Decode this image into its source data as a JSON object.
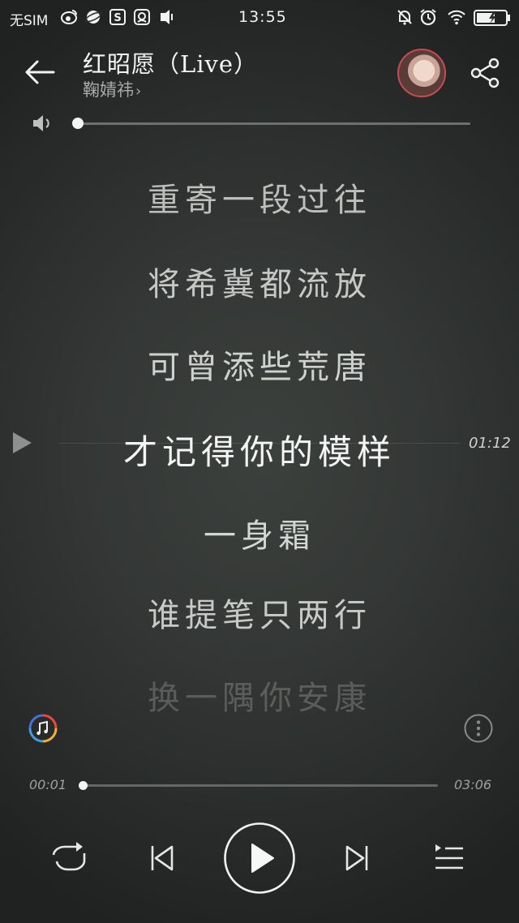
{
  "status_bar": {
    "sim": "无SIM",
    "time": "13:55",
    "icons": [
      "weibo-icon",
      "planet-icon",
      "s-icon",
      "qq-icon",
      "vibrate-icon",
      "mute-bell-icon",
      "alarm-icon",
      "wifi-icon",
      "battery-charging-icon"
    ]
  },
  "header": {
    "title": "红昭愿（Live）",
    "artist": "鞠婧祎",
    "artist_chevron": "›"
  },
  "volume": {
    "level": 0.0
  },
  "lyrics": {
    "lines": [
      {
        "text": "重寄一段过往",
        "state": "past"
      },
      {
        "text": "将希冀都流放",
        "state": "past"
      },
      {
        "text": "可曾添些荒唐",
        "state": "past"
      },
      {
        "text": "才记得你的模样",
        "state": "current"
      },
      {
        "text": "一身霜",
        "state": "next"
      },
      {
        "text": "谁提笔只两行",
        "state": "next"
      },
      {
        "text": "换一隅你安康",
        "state": "fade"
      }
    ],
    "current_time": "01:12"
  },
  "progress": {
    "elapsed": "00:01",
    "total": "03:06",
    "fraction": 0.005
  },
  "controls": {
    "repeat": "repeat-icon",
    "previous": "skip-previous-icon",
    "play": "play-icon",
    "next": "skip-next-icon",
    "playlist": "playlist-icon"
  },
  "colors": {
    "background": "#2b2e2c",
    "avatar_ring": "#c84a55",
    "text_primary": "#f3f3f3",
    "text_secondary": "#a8aaa8"
  }
}
